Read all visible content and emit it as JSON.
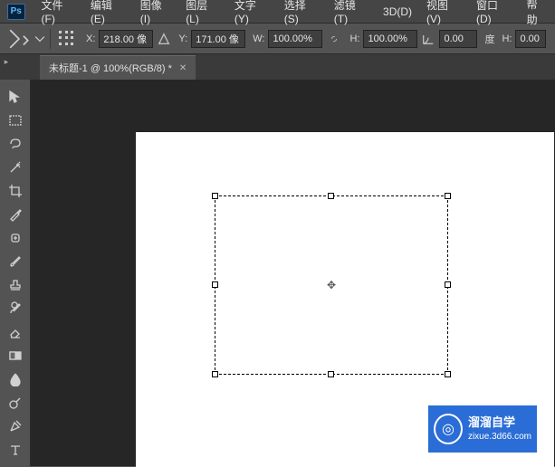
{
  "app": {
    "logo": "Ps"
  },
  "menu": {
    "file": "文件(F)",
    "edit": "编辑(E)",
    "image": "图像(I)",
    "layer": "图层(L)",
    "type": "文字(Y)",
    "select": "选择(S)",
    "filter": "滤镜(T)",
    "threed": "3D(D)",
    "view": "视图(V)",
    "window": "窗口(D)",
    "help": "帮助"
  },
  "options": {
    "x_label": "X:",
    "x_value": "218.00 像",
    "y_label": "Y:",
    "y_value": "171.00 像",
    "w_label": "W:",
    "w_value": "100.00%",
    "h_label": "H:",
    "h_value": "100.00%",
    "angle_value": "0.00",
    "angle_unit": "度",
    "h2_label": "H:",
    "h2_value": "0.00"
  },
  "tab": {
    "title": "未标题-1 @ 100%(RGB/8) *"
  },
  "watermark": {
    "line1": "溜溜自学",
    "line2": "zixue.3d66.com"
  }
}
